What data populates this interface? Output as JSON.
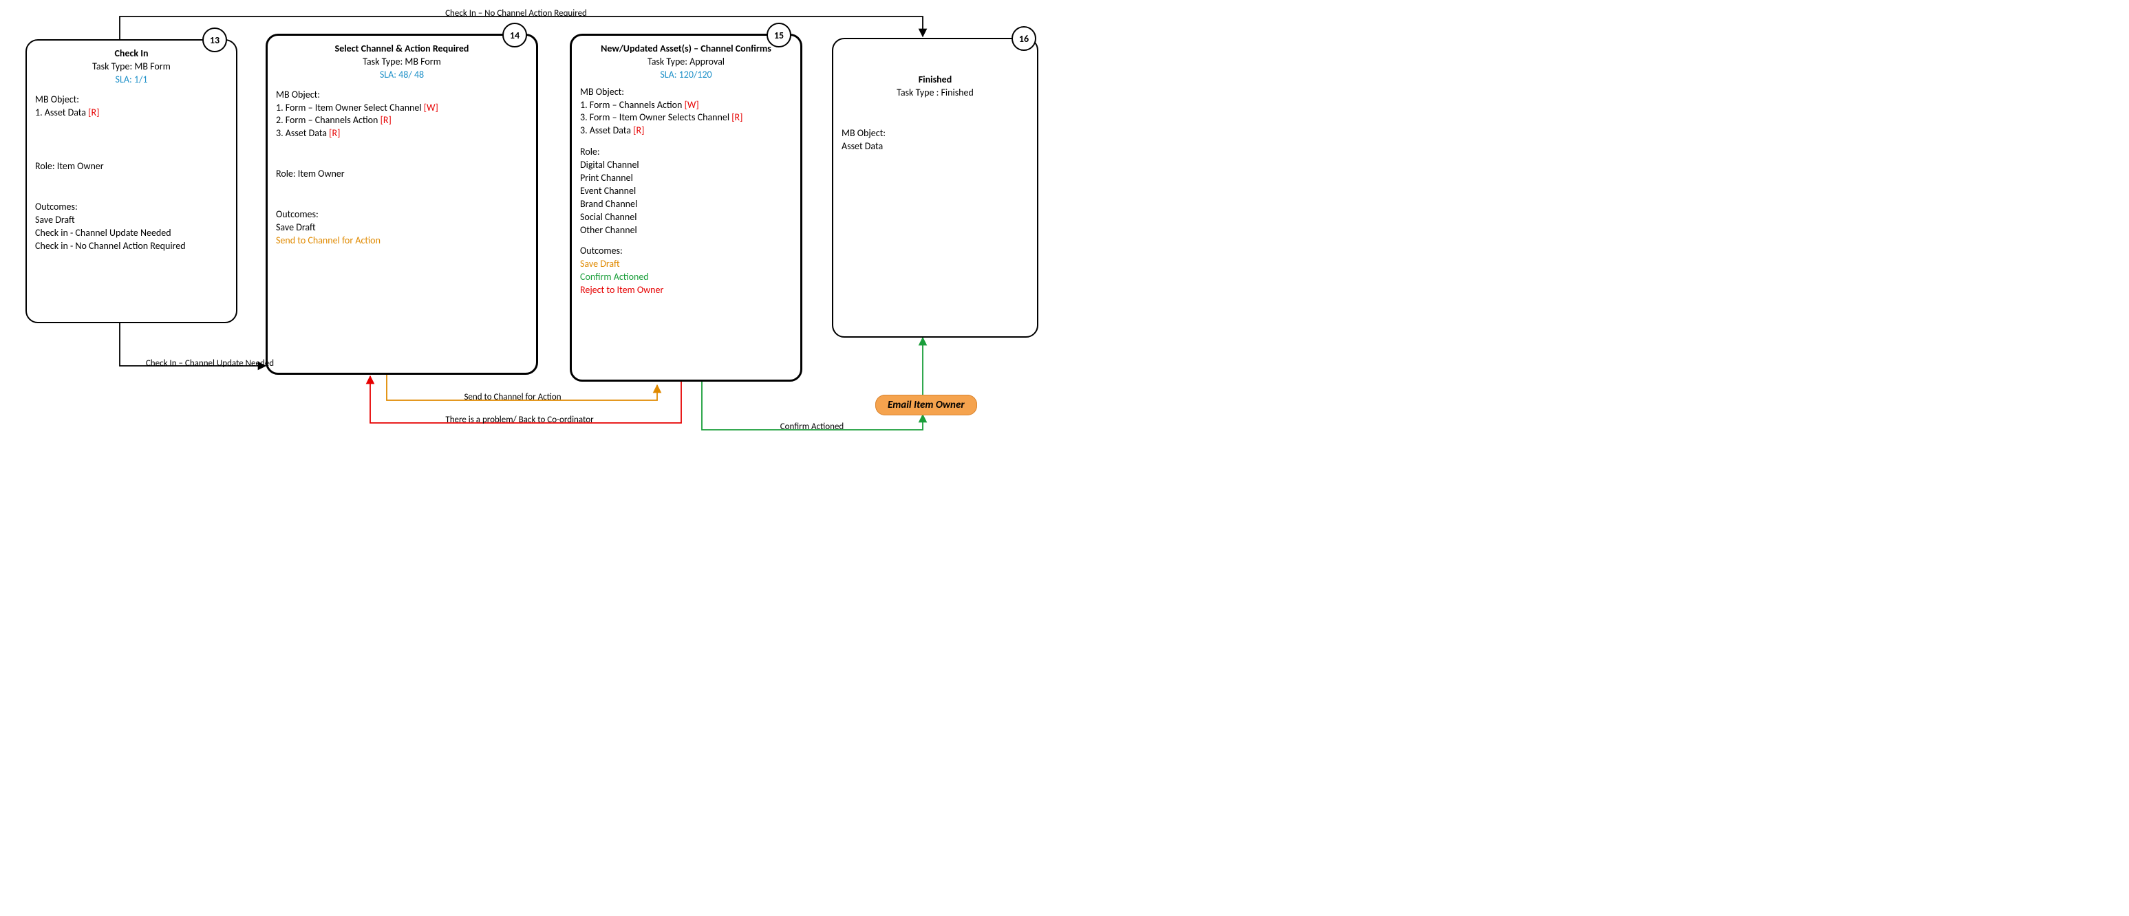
{
  "nodes": {
    "n13": {
      "num": "13",
      "title": "Check In",
      "taskType": "Task Type: MB Form",
      "sla": "SLA: 1/1",
      "mbHeader": "MB Object:",
      "mb1_text": "1. Asset Data ",
      "mb1_flag": "[R]",
      "role": "Role: Item Owner",
      "outHeader": "Outcomes:",
      "out1": "Save Draft",
      "out2": "Check in - Channel Update Needed",
      "out3": "Check in - No Channel Action Required"
    },
    "n14": {
      "num": "14",
      "title": "Select Channel & Action Required",
      "taskType": "Task Type: MB Form",
      "sla": "SLA: 48/ 48",
      "mbHeader": "MB Object:",
      "mb1_text": "1. Form – Item Owner Select Channel ",
      "mb1_flag": "[W]",
      "mb2_text": "2. Form – Channels Action ",
      "mb2_flag": "[R]",
      "mb3_text": "3. Asset Data ",
      "mb3_flag": "[R]",
      "role": "Role: Item Owner",
      "outHeader": "Outcomes:",
      "out1": "Save Draft",
      "out2": "Send to Channel for Action"
    },
    "n15": {
      "num": "15",
      "title": "New/Updated Asset(s) – Channel Confirms",
      "taskType": "Task Type: Approval",
      "sla": "SLA: 120/120",
      "mbHeader": "MB Object:",
      "mb1_text": "1. Form – Channels Action ",
      "mb1_flag": "[W]",
      "mb2_text": "3. Form – Item Owner Selects Channel ",
      "mb2_flag": "[R]",
      "mb3_text": "3. Asset Data ",
      "mb3_flag": "[R]",
      "roleHeader": "Role:",
      "role1": "Digital Channel",
      "role2": "Print Channel",
      "role3": "Event Channel",
      "role4": "Brand Channel",
      "role5": "Social Channel",
      "role6": "Other Channel",
      "outHeader": "Outcomes:",
      "out1": "Save Draft",
      "out2": "Confirm Actioned",
      "out3": "Reject to Item Owner"
    },
    "n16": {
      "num": "16",
      "title": "Finished",
      "taskType": "Task Type : Finished",
      "mbHeader": "MB Object:",
      "mb1": "Asset Data"
    },
    "email": {
      "label": "Email Item Owner"
    }
  },
  "edges": {
    "e1": "Check In – No Channel Action Required",
    "e2": "Check In – Channel Update Needed",
    "e3": "Send to Channel for Action",
    "e4": "There is a problem/ Back to Co-ordinator",
    "e5": "Confirm Actioned"
  }
}
